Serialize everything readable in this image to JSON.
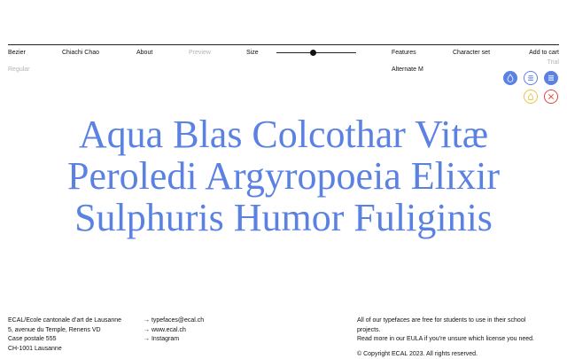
{
  "nav": {
    "typeface": "Bezier",
    "designer": "Chiachi Chao",
    "about": "About",
    "preview": "Preview",
    "size": "Size",
    "features": "Features",
    "character_set": "Character set",
    "add_to_cart": "Add to cart"
  },
  "controls": {
    "style": "Regular",
    "feature": "Alternate M",
    "trial": "Trial",
    "size_level": 0.46
  },
  "colors": {
    "accent": "#5b82e3",
    "warning": "#e8c44a",
    "danger": "#e0443a"
  },
  "icons": {
    "row1": [
      "drop-icon",
      "align-center-icon",
      "align-justify-icon"
    ],
    "row2": [
      "invert-icon",
      "close-icon"
    ]
  },
  "specimen": {
    "lines": [
      "Aqua Blas Colcothar Vitæ",
      "Peroledi Argyropoeia Elixir",
      "Sulphuris Humor Fuliginis"
    ]
  },
  "footer": {
    "address": [
      "ECAL/Ecole cantonale d’art de Lausanne",
      "5, avenue du Temple, Renens VD",
      "Case postale 555",
      "CH-1001 Lausanne"
    ],
    "links": [
      "→ typefaces@ecal.ch",
      "→ www.ecal.ch",
      "→ Instagram"
    ],
    "notice": [
      "All of our typefaces are free for students to use in their school",
      "projects.",
      "Read more in our EULA if you’re unsure which license you need."
    ],
    "copyright": "© Copyright ECAL 2023. All rights reserved."
  }
}
